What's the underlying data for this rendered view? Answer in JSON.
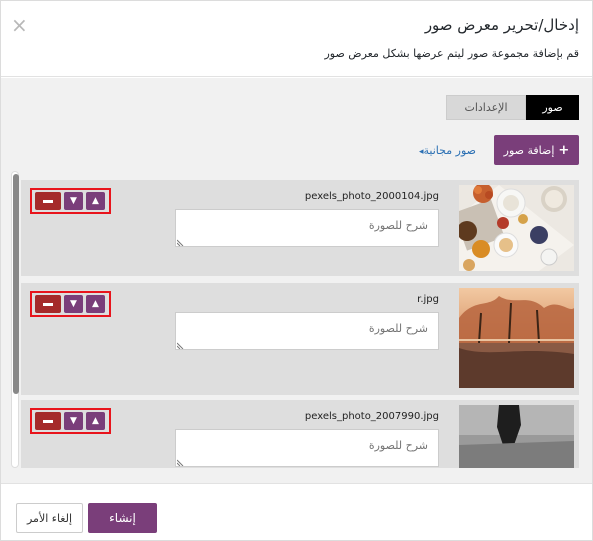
{
  "header": {
    "title": "إدخال/تحرير معرض صور",
    "subtitle": "قم بإضافة مجموعة صور ليتم عرضها بشكل معرض صور",
    "close_icon": "×"
  },
  "tabs": [
    {
      "label": "صور",
      "active": true
    },
    {
      "label": "الإعدادات",
      "active": false
    }
  ],
  "toolbar": {
    "add_label": "إضافة صور",
    "add_icon": "+",
    "free_label": "صور مجانية",
    "free_caret": "◂"
  },
  "items": [
    {
      "filename": "pexels_photo_2000104.jpg",
      "caption": "",
      "caption_placeholder": "شرح للصورة"
    },
    {
      "filename": "r.jpg",
      "caption": "",
      "caption_placeholder": "شرح للصورة"
    },
    {
      "filename": "pexels_photo_2007990.jpg",
      "caption": "",
      "caption_placeholder": "شرح للصورة"
    }
  ],
  "controls": {
    "up_glyph": "▲",
    "down_glyph": "▼"
  },
  "footer": {
    "create_label": "إنشاء",
    "cancel_label": "إلغاء الأمر"
  },
  "colors": {
    "accent": "#7a3e7a",
    "remove": "#a52a2a",
    "highlight": "#e8141c",
    "link": "#2a6fb3"
  }
}
